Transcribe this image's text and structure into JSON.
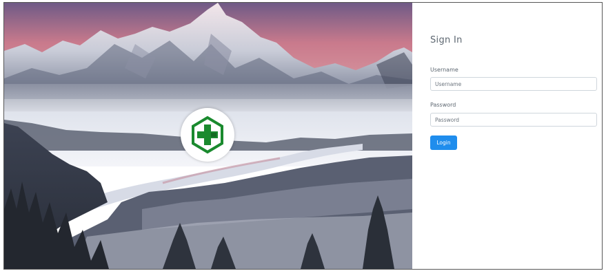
{
  "hero": {
    "image_alt": "winter mountain landscape",
    "logo_icon": "green-cross-hexagon-icon",
    "logo_color": "#1a8a2e"
  },
  "signin": {
    "title": "Sign In",
    "username_label": "Username",
    "username_placeholder": "Username",
    "username_value": "",
    "password_label": "Password",
    "password_placeholder": "Password",
    "password_value": "",
    "login_label": "Login"
  },
  "colors": {
    "accent": "#1f8ded",
    "text": "#5c6670",
    "border": "#cfd6dc"
  }
}
